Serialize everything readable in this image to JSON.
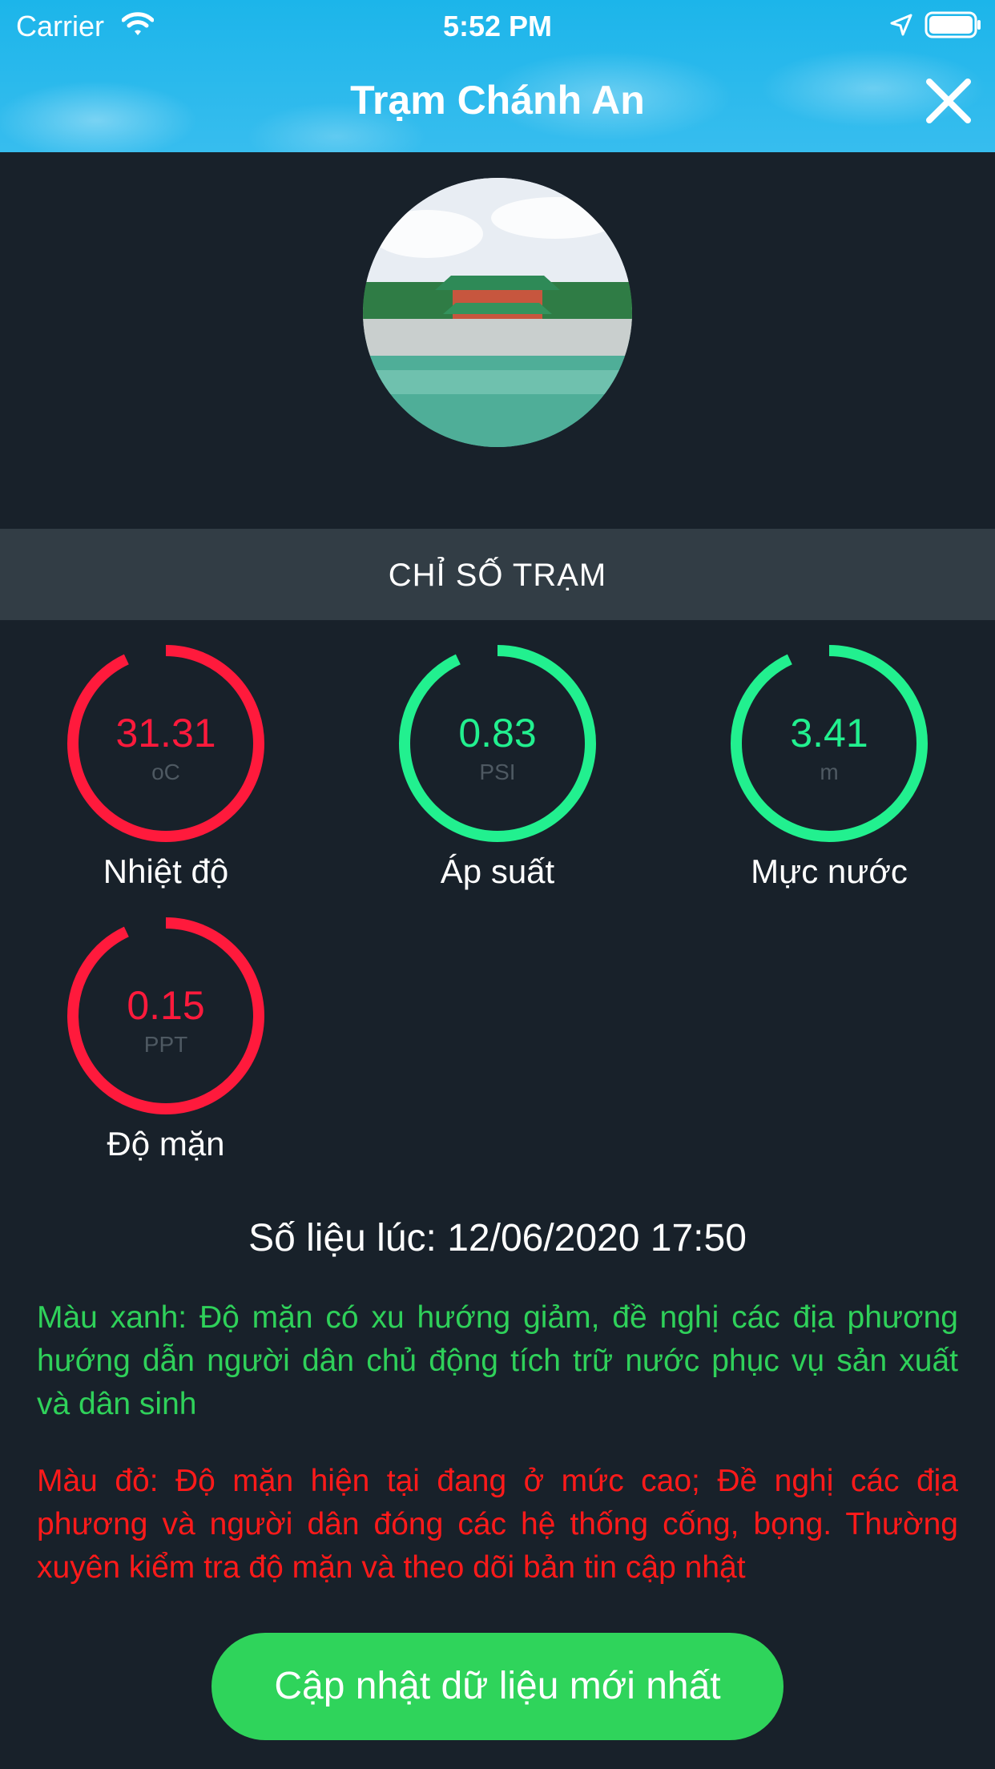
{
  "status": {
    "carrier": "Carrier",
    "time": "5:52 PM"
  },
  "header": {
    "title": "Trạm Chánh An"
  },
  "section": {
    "title": "CHỈ SỐ TRẠM"
  },
  "gauges": [
    {
      "value": "31.31",
      "unit": "oC",
      "label": "Nhiệt độ",
      "color": "#ff1a3c",
      "fill": 0.93
    },
    {
      "value": "0.83",
      "unit": "PSI",
      "label": "Áp suất",
      "color": "#22f08f",
      "fill": 0.93
    },
    {
      "value": "3.41",
      "unit": "m",
      "label": "Mực nước",
      "color": "#22f08f",
      "fill": 0.93
    },
    {
      "value": "0.15",
      "unit": "PPT",
      "label": "Độ mặn",
      "color": "#ff1a3c",
      "fill": 0.93
    }
  ],
  "timestamp": "Số liệu lúc: 12/06/2020 17:50",
  "notes": {
    "green": "Màu xanh: Độ mặn có xu hướng giảm, đề nghị các địa phương hướng dẫn người dân chủ động tích trữ nước phục vụ sản xuất và dân sinh",
    "red": "Màu đỏ: Độ mặn hiện tại đang ở mức cao; Đề nghị các địa phương và người dân đóng các hệ thống cống, bọng. Thường xuyên kiểm tra độ mặn và theo dõi bản tin cập nhật"
  },
  "button": {
    "label": "Cập nhật dữ liệu mới nhất"
  },
  "icons": {
    "wifi": "wifi-icon",
    "location": "location-arrow-icon",
    "battery": "battery-icon",
    "close": "close-icon"
  }
}
